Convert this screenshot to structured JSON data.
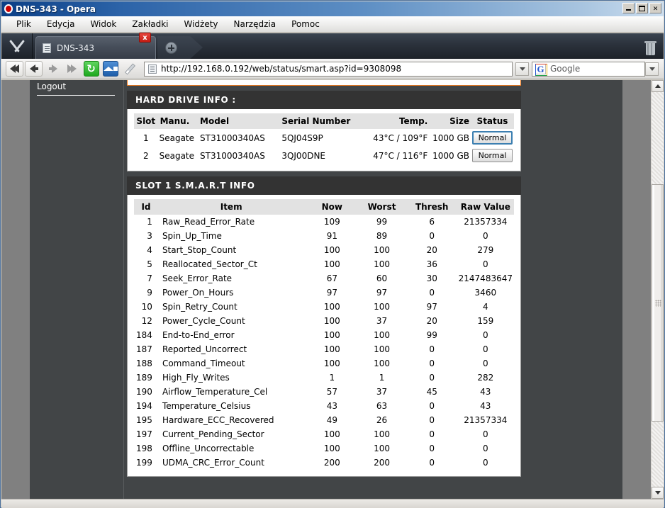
{
  "window": {
    "title": "DNS-343 - Opera",
    "icon": "opera-logo-icon",
    "controls": {
      "minimize": "_",
      "maximize": "□",
      "close": "×"
    }
  },
  "menubar": {
    "items": [
      {
        "label": "Plik"
      },
      {
        "label": "Edycja"
      },
      {
        "label": "Widok"
      },
      {
        "label": "Zakładki"
      },
      {
        "label": "Widżety"
      },
      {
        "label": "Narzędzia"
      },
      {
        "label": "Pomoc"
      }
    ]
  },
  "tabbar": {
    "tool_button": "wrench-icon",
    "tabs": [
      {
        "label": "DNS-343",
        "close_label": "x",
        "active": true
      }
    ],
    "new_tab_label": "+",
    "trash_label": "trash-icon"
  },
  "addressbar": {
    "buttons": [
      {
        "name": "rewind-button",
        "glyph": "«"
      },
      {
        "name": "back-button",
        "glyph": "←"
      },
      {
        "name": "forward-button",
        "glyph": "→"
      },
      {
        "name": "fast-forward-button",
        "glyph": "»"
      },
      {
        "name": "reload-button",
        "glyph": "↻"
      },
      {
        "name": "home-button",
        "glyph": "⌂"
      },
      {
        "name": "edit-button",
        "glyph": "✎"
      }
    ],
    "url": "http://192.168.0.192/web/status/smart.asp?id=9308098",
    "search_engine": "Google",
    "search_engine_initial": "G",
    "search_placeholder": "Google"
  },
  "page": {
    "sidebar": {
      "logout_label": "Logout"
    },
    "hard_drive_info": {
      "title": "HARD DRIVE INFO :",
      "columns": [
        "Slot",
        "Manu.",
        "Model",
        "Serial Number",
        "Temp.",
        "Size",
        "Status"
      ],
      "rows": [
        {
          "slot": "1",
          "manu": "Seagate",
          "model": "ST31000340AS",
          "serial": "5QJ04S9P",
          "temp": "43°C / 109°F",
          "size": "1000 GB",
          "status": "Normal",
          "status_focused": true
        },
        {
          "slot": "2",
          "manu": "Seagate",
          "model": "ST31000340AS",
          "serial": "3QJ00DNE",
          "temp": "47°C / 116°F",
          "size": "1000 GB",
          "status": "Normal",
          "status_focused": false
        }
      ]
    },
    "smart_info": {
      "title": "SLOT 1 S.M.A.R.T INFO",
      "columns": [
        "Id",
        "Item",
        "Now",
        "Worst",
        "Thresh",
        "Raw Value"
      ],
      "rows": [
        {
          "id": "1",
          "item": "Raw_Read_Error_Rate",
          "now": "109",
          "worst": "99",
          "thresh": "6",
          "raw": "21357334"
        },
        {
          "id": "3",
          "item": "Spin_Up_Time",
          "now": "91",
          "worst": "89",
          "thresh": "0",
          "raw": "0"
        },
        {
          "id": "4",
          "item": "Start_Stop_Count",
          "now": "100",
          "worst": "100",
          "thresh": "20",
          "raw": "279"
        },
        {
          "id": "5",
          "item": "Reallocated_Sector_Ct",
          "now": "100",
          "worst": "100",
          "thresh": "36",
          "raw": "0"
        },
        {
          "id": "7",
          "item": "Seek_Error_Rate",
          "now": "67",
          "worst": "60",
          "thresh": "30",
          "raw": "2147483647"
        },
        {
          "id": "9",
          "item": "Power_On_Hours",
          "now": "97",
          "worst": "97",
          "thresh": "0",
          "raw": "3460"
        },
        {
          "id": "10",
          "item": "Spin_Retry_Count",
          "now": "100",
          "worst": "100",
          "thresh": "97",
          "raw": "4"
        },
        {
          "id": "12",
          "item": "Power_Cycle_Count",
          "now": "100",
          "worst": "37",
          "thresh": "20",
          "raw": "159"
        },
        {
          "id": "184",
          "item": "End-to-End_error",
          "now": "100",
          "worst": "100",
          "thresh": "99",
          "raw": "0"
        },
        {
          "id": "187",
          "item": "Reported_Uncorrect",
          "now": "100",
          "worst": "100",
          "thresh": "0",
          "raw": "0"
        },
        {
          "id": "188",
          "item": "Command_Timeout",
          "now": "100",
          "worst": "100",
          "thresh": "0",
          "raw": "0"
        },
        {
          "id": "189",
          "item": "High_Fly_Writes",
          "now": "1",
          "worst": "1",
          "thresh": "0",
          "raw": "282"
        },
        {
          "id": "190",
          "item": "Airflow_Temperature_Cel",
          "now": "57",
          "worst": "37",
          "thresh": "45",
          "raw": "43"
        },
        {
          "id": "194",
          "item": "Temperature_Celsius",
          "now": "43",
          "worst": "63",
          "thresh": "0",
          "raw": "43"
        },
        {
          "id": "195",
          "item": "Hardware_ECC_Recovered",
          "now": "49",
          "worst": "26",
          "thresh": "0",
          "raw": "21357334"
        },
        {
          "id": "197",
          "item": "Current_Pending_Sector",
          "now": "100",
          "worst": "100",
          "thresh": "0",
          "raw": "0"
        },
        {
          "id": "198",
          "item": "Offline_Uncorrectable",
          "now": "100",
          "worst": "100",
          "thresh": "0",
          "raw": "0"
        },
        {
          "id": "199",
          "item": "UDMA_CRC_Error_Count",
          "now": "200",
          "worst": "200",
          "thresh": "0",
          "raw": "0"
        }
      ]
    }
  },
  "colors": {
    "accent_orange": "#f07c1f",
    "panel_header": "#333333",
    "page_background": "#424547",
    "titlebar_blue": "#2c63a8"
  }
}
